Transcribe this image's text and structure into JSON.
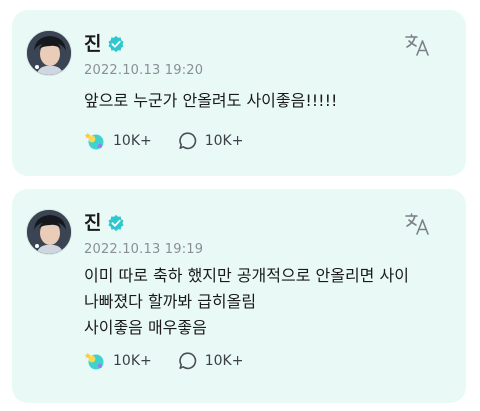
{
  "colors": {
    "card_background": "#e9faf6",
    "verified_badge": "#2fc6cf",
    "text_primary": "#1a1a1a",
    "text_secondary": "#8a8f96",
    "accent_cyan": "#3fd3cf"
  },
  "posts": [
    {
      "author": "진",
      "verified": true,
      "timestamp": "2022.10.13 19:20",
      "body": [
        "앞으로 누군가 안올려도 사이좋음!!!!!"
      ],
      "likes": "10K+",
      "comments": "10K+",
      "icons": [
        "avatar",
        "verified-badge-icon",
        "translate-icon",
        "like-icon",
        "comment-icon"
      ]
    },
    {
      "author": "진",
      "verified": true,
      "timestamp": "2022.10.13 19:19",
      "body": [
        "이미 따로 축하 했지만 공개적으로 안올리면 사이",
        "나빠졌다 할까봐 급히올림",
        "사이좋음 매우좋음"
      ],
      "likes": "10K+",
      "comments": "10K+",
      "icons": [
        "avatar",
        "verified-badge-icon",
        "translate-icon",
        "like-icon",
        "comment-icon"
      ]
    }
  ]
}
